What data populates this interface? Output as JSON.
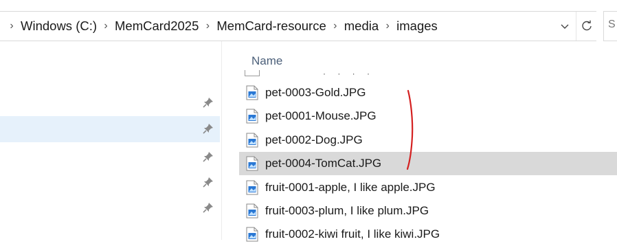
{
  "breadcrumb": {
    "segments": [
      "Windows (C:)",
      "MemCard2025",
      "MemCard-resource",
      "media",
      "images"
    ]
  },
  "search": {
    "partial_label": "S"
  },
  "file_list": {
    "column_header": "Name",
    "rows": [
      {
        "name": "pet-0003-Gold.JPG",
        "selected": false
      },
      {
        "name": "pet-0001-Mouse.JPG",
        "selected": false
      },
      {
        "name": "pet-0002-Dog.JPG",
        "selected": false
      },
      {
        "name": "pet-0004-TomCat.JPG",
        "selected": true
      },
      {
        "name": "fruit-0001-apple, I like apple.JPG",
        "selected": false
      },
      {
        "name": "fruit-0003-plum, I like plum.JPG",
        "selected": false
      },
      {
        "name": "fruit-0002-kiwi fruit, I like kiwi.JPG",
        "selected": false
      }
    ]
  },
  "nav_pane": {
    "pinned_count": 5,
    "selected_index": 1
  },
  "colors": {
    "selection_gray": "#d9d9d9",
    "nav_selection_blue": "#e6f1fb",
    "annotation_red": "#d42020",
    "file_icon_blue": "#2a78d4"
  },
  "icons": {
    "breadcrumb_separator": "chevron-right-icon",
    "address_dropdown": "chevron-down-icon",
    "refresh": "refresh-icon",
    "pin": "pin-icon",
    "file": "image-file-icon"
  }
}
